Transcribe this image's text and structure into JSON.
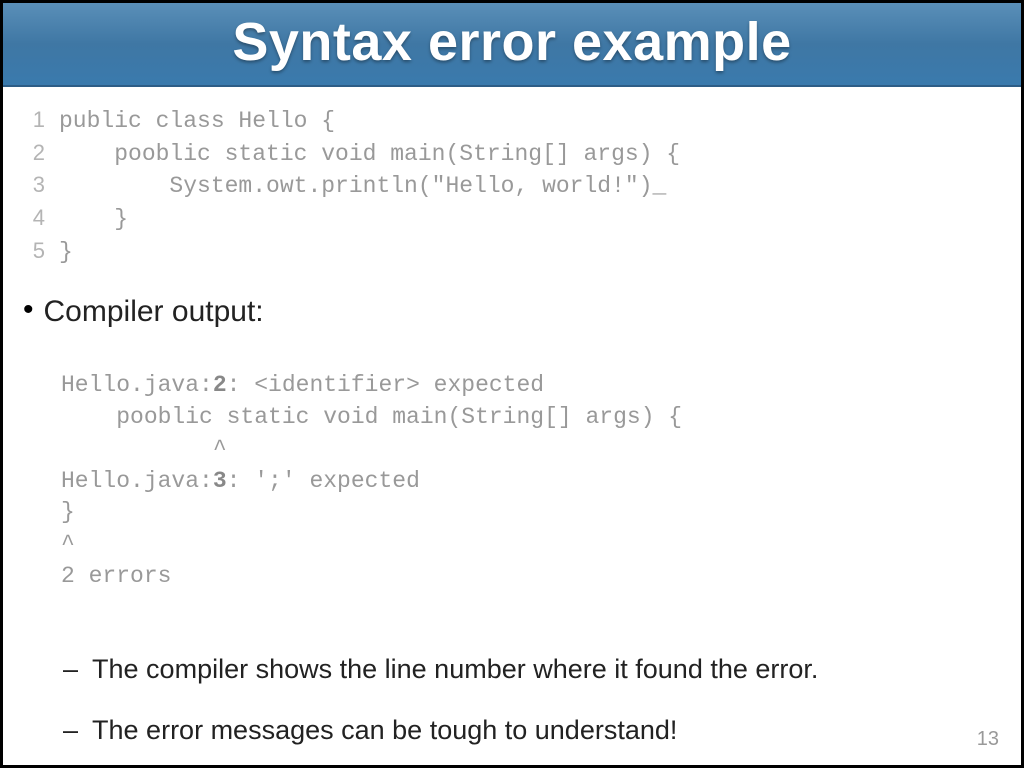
{
  "title": "Syntax error example",
  "code": {
    "lines": [
      {
        "num": "1",
        "text": "public class Hello {"
      },
      {
        "num": "2",
        "text": "    pooblic static void main(String[] args) {"
      },
      {
        "num": "3",
        "text": "        System.owt.println(\"Hello, world!\")_"
      },
      {
        "num": "4",
        "text": "    }"
      },
      {
        "num": "5",
        "text": "}"
      }
    ]
  },
  "bullet": {
    "label": "Compiler output:"
  },
  "compiler_output": {
    "l1a": "Hello.java:",
    "l1n": "2",
    "l1b": ": <identifier> expected",
    "l2": "    pooblic static void main(String[] args) {",
    "l3": "           ^",
    "l4a": "Hello.java:",
    "l4n": "3",
    "l4b": ": ';' expected",
    "l5": "}",
    "l6": "^",
    "l7": "2 errors"
  },
  "sub_bullets": [
    "The compiler shows the line number where it found the error.",
    "The error messages can be tough to understand!"
  ],
  "page_number": "13"
}
